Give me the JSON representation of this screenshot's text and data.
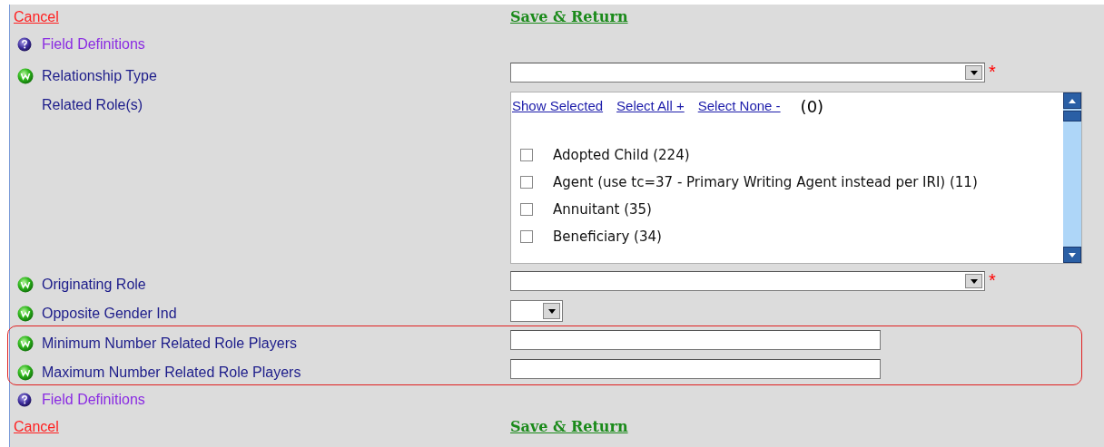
{
  "top_actions": {
    "cancel": "Cancel",
    "save": "Save & Return"
  },
  "rows": [
    {
      "kind": "help",
      "label": "Field Definitions",
      "highlighted": false
    },
    {
      "kind": "select",
      "label": "Relationship Type",
      "required": true,
      "required_mark": "*",
      "highlighted": false
    },
    {
      "kind": "listbox",
      "label": "Related Role(s)",
      "highlighted": false,
      "listbox": {
        "links": [
          "Show Selected",
          "Select All +",
          "Select None -"
        ],
        "count": "(0)",
        "options": [
          {
            "label": "Adopted Child (224)",
            "checked": false
          },
          {
            "label": "Agent (use tc=37 - Primary Writing Agent instead per IRI) (11)",
            "checked": false
          },
          {
            "label": "Annuitant (35)",
            "checked": false
          },
          {
            "label": "Beneficiary (34)",
            "checked": false
          }
        ]
      }
    },
    {
      "kind": "select",
      "label": "Originating Role",
      "required": true,
      "required_mark": "*",
      "highlighted": false
    },
    {
      "kind": "small_select",
      "label": "Opposite Gender Ind",
      "highlighted": false
    },
    {
      "kind": "text",
      "label": "Minimum Number Related Role Players",
      "highlighted": true
    },
    {
      "kind": "text",
      "label": "Maximum Number Related Role Players",
      "highlighted": true
    },
    {
      "kind": "help",
      "label": "Field Definitions",
      "highlighted": false
    }
  ],
  "bottom_actions": {
    "cancel": "Cancel",
    "save": "Save & Return"
  }
}
